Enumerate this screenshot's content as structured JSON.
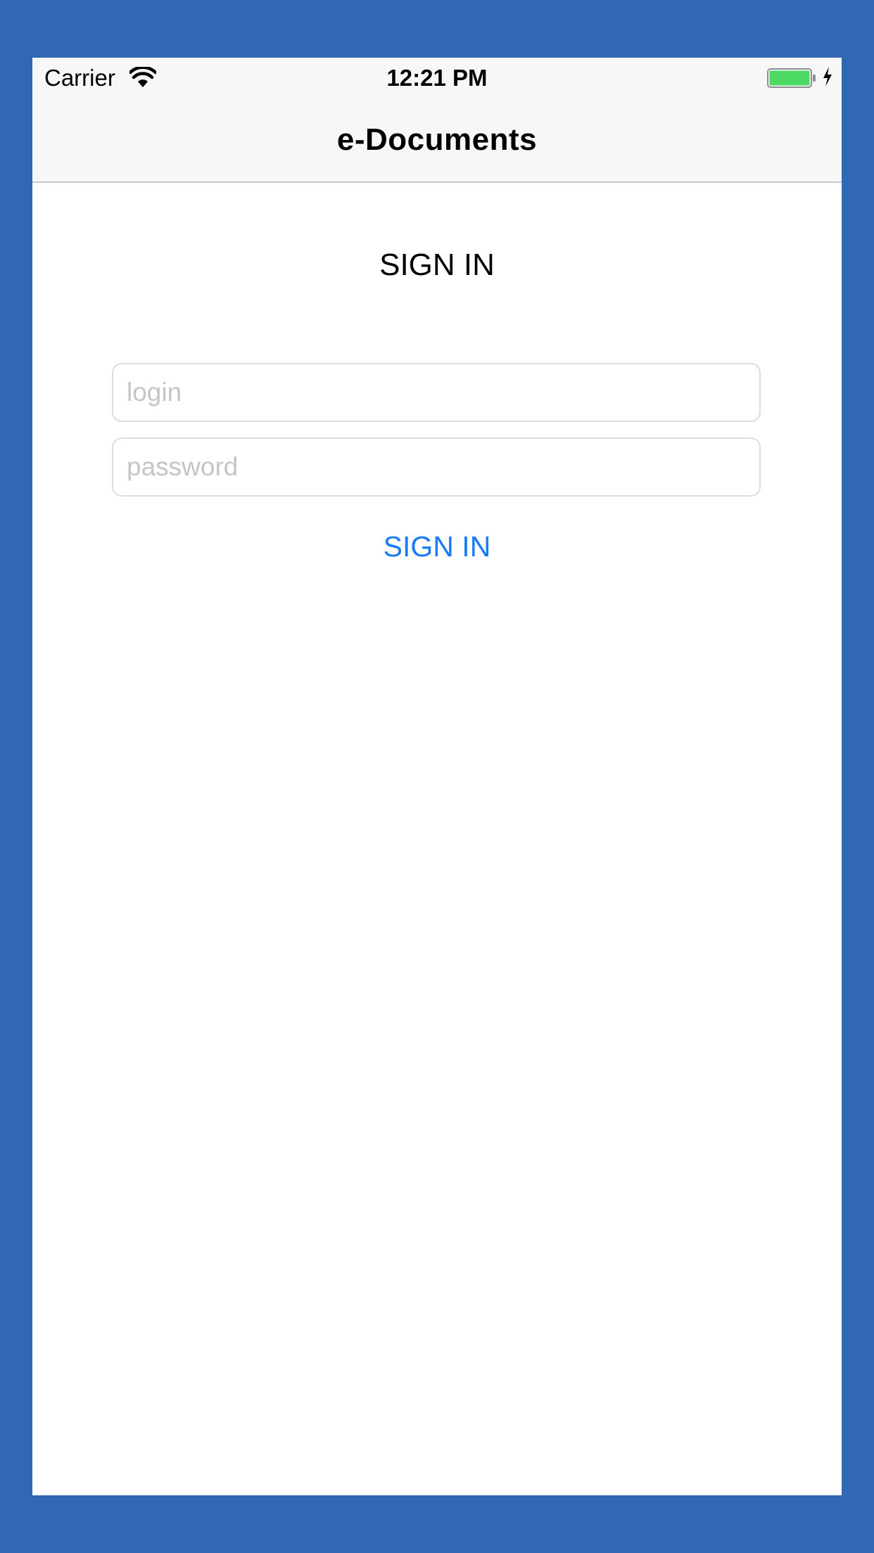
{
  "status_bar": {
    "carrier": "Carrier",
    "time": "12:21 PM",
    "wifi_icon": "wifi-icon",
    "battery_icon": "battery-icon",
    "charging_icon": "charging-bolt-icon",
    "battery_color": "#4cd964"
  },
  "nav": {
    "title": "e-Documents"
  },
  "form": {
    "heading": "SIGN IN",
    "login_placeholder": "login",
    "password_placeholder": "password",
    "submit_label": "SIGN IN",
    "accent_color": "#1a7cf5"
  },
  "background_color": "#3168b3"
}
